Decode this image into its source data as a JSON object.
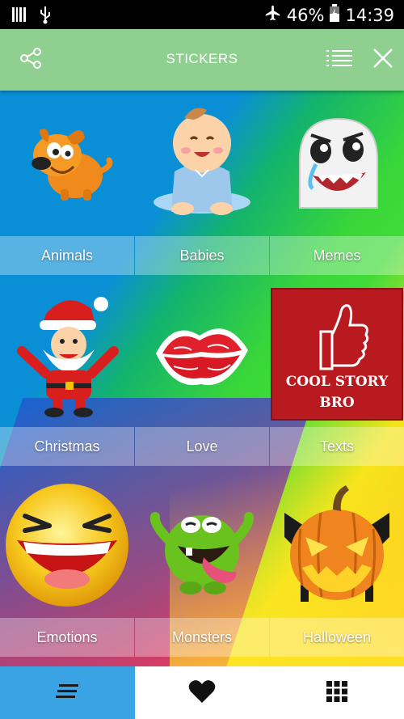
{
  "status_bar": {
    "battery": "46%",
    "time": "14:39"
  },
  "app_bar": {
    "title": "STICKERS"
  },
  "categories": [
    {
      "label": "Animals",
      "icon": "dog-icon"
    },
    {
      "label": "Babies",
      "icon": "baby-icon"
    },
    {
      "label": "Memes",
      "icon": "meme-face-icon"
    },
    {
      "label": "Christmas",
      "icon": "santa-icon"
    },
    {
      "label": "Love",
      "icon": "kiss-lips-icon"
    },
    {
      "label": "Texts",
      "icon": "cool-story-bro-icon",
      "art_text_line1": "COOL STORY",
      "art_text_line2": "BRO"
    },
    {
      "label": "Emotions",
      "icon": "laughing-face-icon"
    },
    {
      "label": "Monsters",
      "icon": "green-monster-icon"
    },
    {
      "label": "Halloween",
      "icon": "pumpkin-icon"
    }
  ],
  "bottom_nav": {
    "items": [
      "menu-lines-icon",
      "heart-icon",
      "grid-icon"
    ],
    "active": "menu-lines-icon"
  },
  "colors": {
    "app_bar": "#8fcf8f",
    "nav_active": "#3aa3e3"
  }
}
